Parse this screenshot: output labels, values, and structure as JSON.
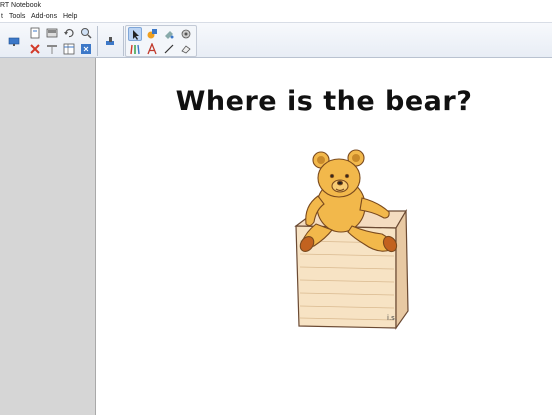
{
  "app": {
    "title": "RT Notebook"
  },
  "menu": {
    "items": [
      {
        "label": "t"
      },
      {
        "label": "Tools"
      },
      {
        "label": "Add-ons"
      },
      {
        "label": "Help"
      }
    ]
  },
  "toolbar": {
    "buttons": [
      "display-icon",
      "open-page-icon",
      "screen-shade-icon",
      "undo-icon",
      "zoom-icon",
      "delete-icon",
      "screen-icon",
      "table-icon",
      "pull-tab-icon",
      "document-camera-icon",
      "select-icon",
      "shapes-icon",
      "pen-icon",
      "fill-icon",
      "magic-pen-icon",
      "text-icon",
      "line-icon",
      "eraser-icon"
    ]
  },
  "slide": {
    "title": "Where is the bear?",
    "image_label": "i.s."
  },
  "colors": {
    "accent": "#3c78c8",
    "sidebar": "#d6d6d6",
    "bear": "#f2b84b",
    "box": "#f7e3c4"
  }
}
